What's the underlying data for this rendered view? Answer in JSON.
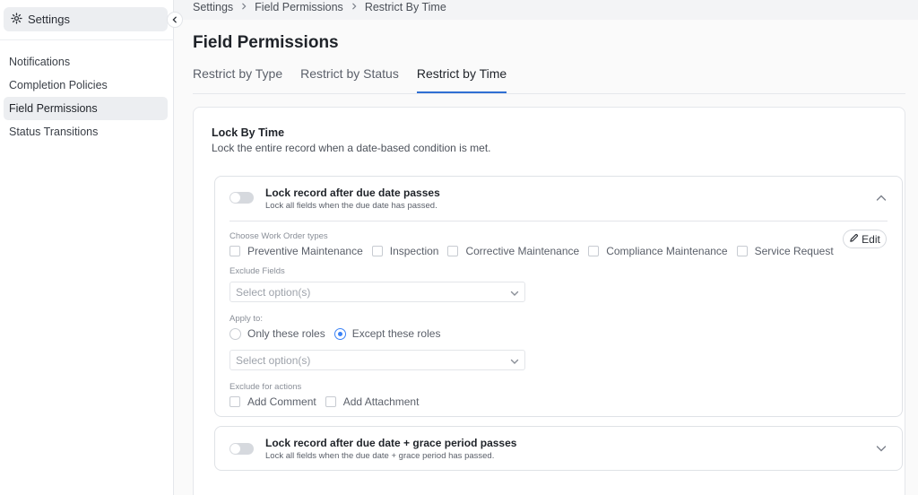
{
  "sidebar": {
    "header_label": "Settings",
    "items": [
      {
        "label": "Notifications",
        "active": false
      },
      {
        "label": "Completion Policies",
        "active": false
      },
      {
        "label": "Field Permissions",
        "active": true
      },
      {
        "label": "Status Transitions",
        "active": false
      }
    ]
  },
  "breadcrumb": [
    "Settings",
    "Field Permissions",
    "Restrict By Time"
  ],
  "page": {
    "title": "Field Permissions",
    "tabs": [
      {
        "label": "Restrict by Type",
        "active": false
      },
      {
        "label": "Restrict by Status",
        "active": false
      },
      {
        "label": "Restrict by Time",
        "active": true
      }
    ]
  },
  "panel": {
    "title": "Lock By Time",
    "description": "Lock the entire record when a date-based condition is met.",
    "rules": [
      {
        "title": "Lock record after due date passes",
        "subtitle": "Lock all fields when the due date has passed.",
        "enabled": false,
        "expanded": true,
        "work_order_types_label": "Choose Work Order types",
        "work_order_types": [
          "Preventive Maintenance",
          "Inspection",
          "Corrective Maintenance",
          "Compliance Maintenance",
          "Service Request"
        ],
        "edit_label": "Edit",
        "exclude_fields_label": "Exclude Fields",
        "exclude_fields_placeholder": "Select option(s)",
        "apply_to_label": "Apply to:",
        "apply_to_options": [
          {
            "label": "Only these roles",
            "selected": false
          },
          {
            "label": "Except these roles",
            "selected": true
          }
        ],
        "roles_placeholder": "Select option(s)",
        "exclude_actions_label": "Exclude for actions",
        "exclude_actions": [
          "Add Comment",
          "Add Attachment"
        ]
      },
      {
        "title": "Lock record after due date + grace period passes",
        "subtitle": "Lock all fields when the due date + grace period has passed.",
        "enabled": false,
        "expanded": false
      }
    ]
  },
  "icons": {
    "settings": "gear-icon",
    "collapse": "chevron-left-icon",
    "breadcrumb_separator": "chevron-right-icon",
    "expand_open": "chevron-up-icon",
    "expand_closed": "chevron-down-icon",
    "edit": "pencil-icon",
    "select_caret": "chevron-down-icon"
  },
  "colors": {
    "accent": "#2f6fd3",
    "radio_selected": "#3b82f6",
    "toggle_off": "#d6d9de"
  }
}
